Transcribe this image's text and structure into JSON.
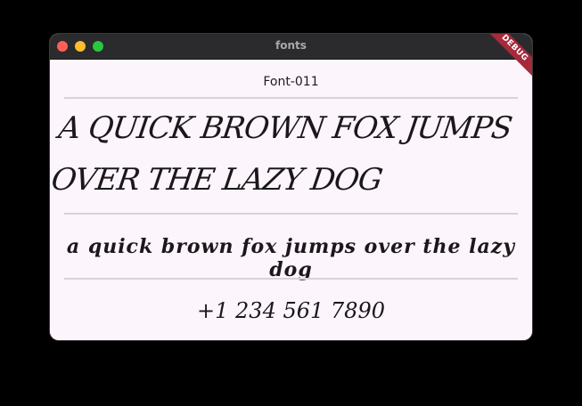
{
  "window": {
    "title": "fonts"
  },
  "content": {
    "font_name": "Font-011",
    "uppercase_sample": "A QUICK BROWN FOX JUMPS OVER THE LAZY DOG",
    "lowercase_sample": "a quick brown fox jumps over the lazy dog",
    "number_sample": "+1 234 561 7890"
  },
  "debug_banner": {
    "label": "DEBUG"
  },
  "colors": {
    "titlebar": "#2b2a2c",
    "background": "#fcf5fb",
    "close": "#fe5f57",
    "minimize": "#febc2e",
    "maximize": "#28c840",
    "debug": "#a52a3c"
  }
}
